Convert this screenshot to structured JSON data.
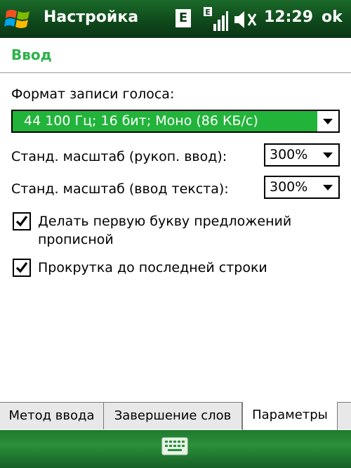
{
  "titlebar": {
    "title": "Настройка",
    "network": "E",
    "time": "12:29",
    "ok_label": "ok"
  },
  "page": {
    "title": "Ввод"
  },
  "voice": {
    "label": "Формат записи голоса:",
    "value": "44 100 Гц; 16 бит; Моно (86 КБ/с)"
  },
  "scale_handwriting": {
    "label": "Станд. масштаб (рукоп. ввод):",
    "value": "300%"
  },
  "scale_text": {
    "label": "Станд. масштаб (ввод текста):",
    "value": "300%"
  },
  "checkboxes": [
    {
      "label_line1": "Делать первую букву предложений",
      "label_line2": "прописной",
      "checked": true
    },
    {
      "label_line1": "Прокрутка до последней строки",
      "checked": true
    }
  ],
  "tabs": [
    {
      "label": "Метод ввода",
      "active": false
    },
    {
      "label": "Завершение слов",
      "active": false
    },
    {
      "label": "Параметры",
      "active": true
    }
  ],
  "icons": {
    "start": "windows-flag-icon",
    "signal": "signal-strength-icon",
    "volume": "speaker-muted-icon",
    "keyboard": "keyboard-icon"
  },
  "colors": {
    "title_bar": "#0f4a1b",
    "accent_green": "#2db14a",
    "selection_green": "#22b33b"
  }
}
